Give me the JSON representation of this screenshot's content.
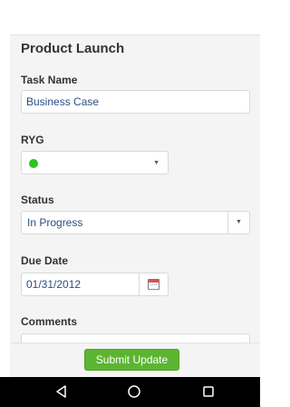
{
  "header": {
    "title": "Product Launch"
  },
  "form": {
    "task_name": {
      "label": "Task Name",
      "value": "Business Case"
    },
    "ryg": {
      "label": "RYG",
      "value_color": "#2ec21d",
      "caret": "▼"
    },
    "status": {
      "label": "Status",
      "value": "In Progress",
      "caret": "▼"
    },
    "due_date": {
      "label": "Due Date",
      "value": "01/31/2012",
      "icon": "calendar-icon"
    },
    "comments": {
      "label": "Comments",
      "value": ""
    }
  },
  "footer": {
    "submit_label": "Submit Update",
    "submit_color": "#5cb531"
  },
  "android_nav": {
    "back_icon": "back-triangle-icon",
    "home_icon": "home-circle-icon",
    "recents_icon": "recents-square-icon"
  }
}
